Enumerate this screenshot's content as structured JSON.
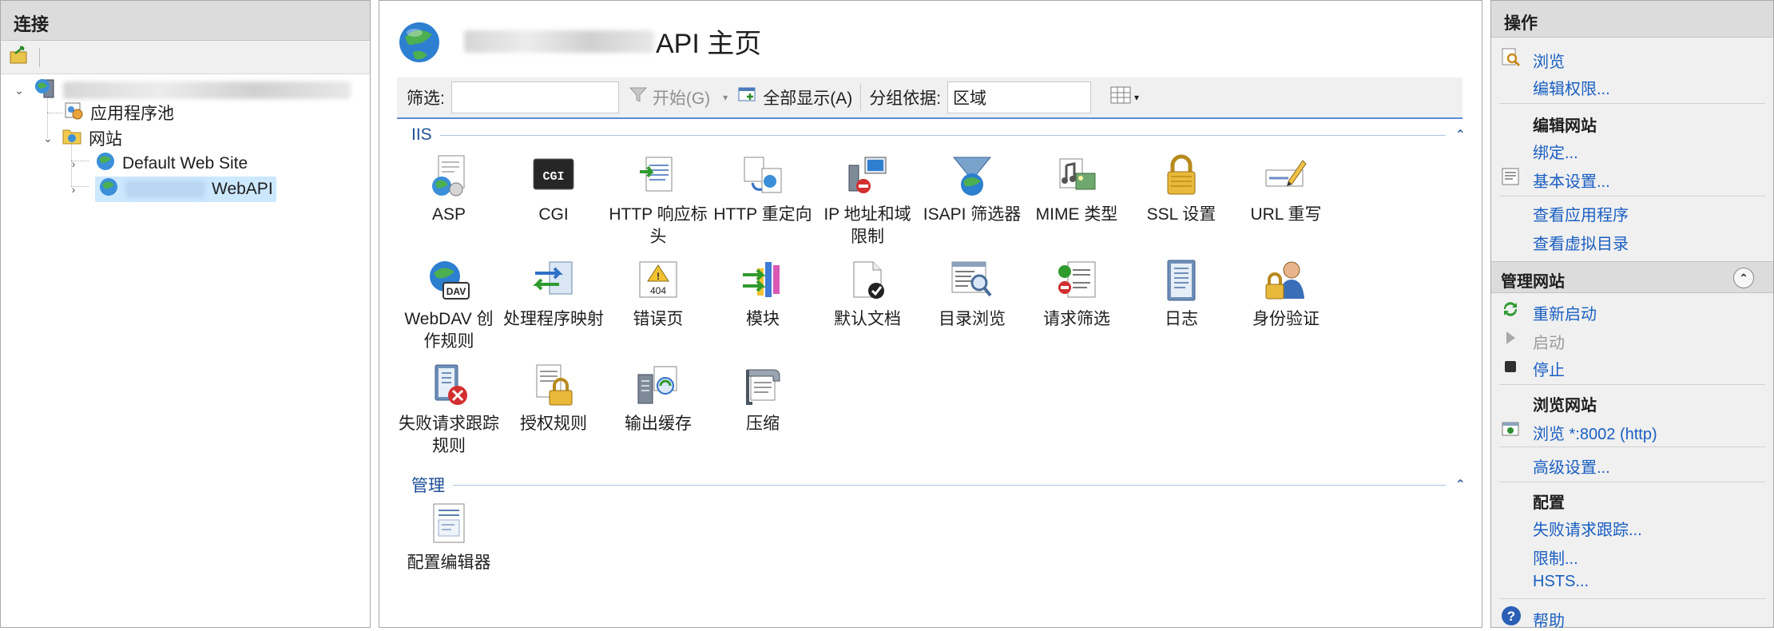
{
  "connections": {
    "header": "连接",
    "tree": {
      "server_label_blurred": true,
      "app_pools": "应用程序池",
      "sites": "网站",
      "default_site": "Default Web Site",
      "api_site_suffix": "WebAPI"
    }
  },
  "main": {
    "title_suffix": "API 主页",
    "filter": {
      "label": "筛选:",
      "input_value": "",
      "go_label": "开始(G)",
      "show_all_label": "全部显示(A)",
      "groupby_label": "分组依据:",
      "groupby_value": "区域"
    },
    "groups": {
      "iis": "IIS",
      "manage": "管理"
    },
    "features_iis": [
      {
        "label": "ASP",
        "icon": "asp-icon"
      },
      {
        "label": "CGI",
        "icon": "cgi-icon"
      },
      {
        "label": "HTTP 响应标头",
        "icon": "http-response-headers-icon"
      },
      {
        "label": "HTTP 重定向",
        "icon": "http-redirect-icon"
      },
      {
        "label": "IP 地址和域限制",
        "icon": "ip-restrictions-icon"
      },
      {
        "label": "ISAPI 筛选器",
        "icon": "isapi-filters-icon"
      },
      {
        "label": "MIME 类型",
        "icon": "mime-types-icon"
      },
      {
        "label": "SSL 设置",
        "icon": "ssl-settings-icon"
      },
      {
        "label": "URL 重写",
        "icon": "url-rewrite-icon"
      },
      {
        "label": "WebDAV 创作规则",
        "icon": "webdav-icon"
      },
      {
        "label": "处理程序映射",
        "icon": "handler-mappings-icon"
      },
      {
        "label": "错误页",
        "icon": "error-pages-icon"
      },
      {
        "label": "模块",
        "icon": "modules-icon"
      },
      {
        "label": "默认文档",
        "icon": "default-document-icon"
      },
      {
        "label": "目录浏览",
        "icon": "directory-browsing-icon"
      },
      {
        "label": "请求筛选",
        "icon": "request-filtering-icon"
      },
      {
        "label": "日志",
        "icon": "logging-icon"
      },
      {
        "label": "身份验证",
        "icon": "authentication-icon"
      },
      {
        "label": "失败请求跟踪规则",
        "icon": "failed-request-tracing-icon"
      },
      {
        "label": "授权规则",
        "icon": "authorization-rules-icon"
      },
      {
        "label": "输出缓存",
        "icon": "output-caching-icon"
      },
      {
        "label": "压缩",
        "icon": "compression-icon"
      }
    ],
    "features_manage": [
      {
        "label": "配置编辑器",
        "icon": "config-editor-icon"
      }
    ]
  },
  "actions": {
    "header": "操作",
    "browse": "浏览",
    "edit_permissions": "编辑权限...",
    "edit_site_header": "编辑网站",
    "bindings": "绑定...",
    "basic_settings": "基本设置...",
    "view_applications": "查看应用程序",
    "view_vdirs": "查看虚拟目录",
    "manage_site_header": "管理网站",
    "restart": "重新启动",
    "start": "启动",
    "stop": "停止",
    "browse_site_header": "浏览网站",
    "browse_port": "浏览 *:8002 (http)",
    "advanced_settings": "高级设置...",
    "configure_header": "配置",
    "failed_request_tracing": "失败请求跟踪...",
    "limits": "限制...",
    "hsts": "HSTS...",
    "help": "帮助"
  }
}
